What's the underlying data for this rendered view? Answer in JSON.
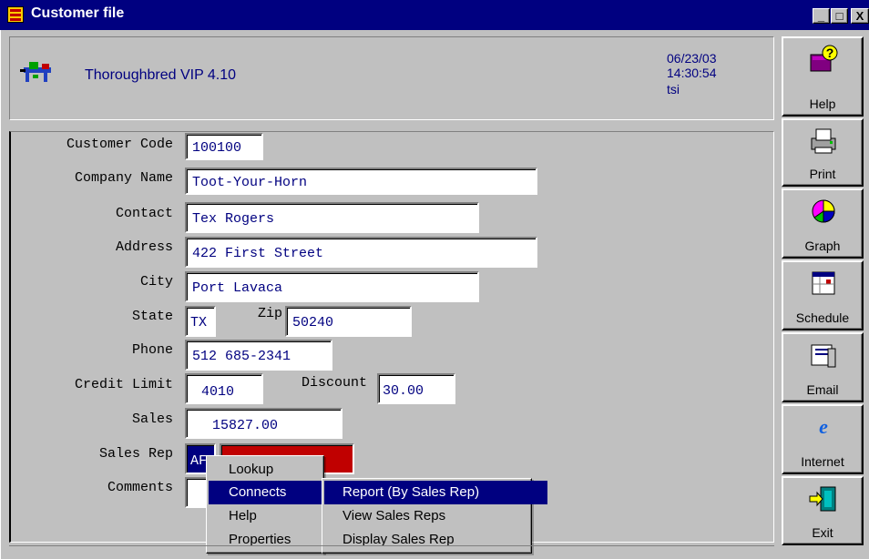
{
  "window": {
    "title": "Customer file",
    "buttons": [
      "_",
      "□",
      "X"
    ]
  },
  "header": {
    "app_name": "Thoroughbred VIP 4.10",
    "date": "06/23/03",
    "time": "14:30:54",
    "user": "tsi",
    "logo_icon": "running-horse-icon"
  },
  "form": {
    "customer_code": {
      "label": "Customer Code",
      "value": "100100"
    },
    "company_name": {
      "label": "Company Name",
      "value": "Toot-Your-Horn"
    },
    "contact": {
      "label": "Contact",
      "value": "Tex Rogers"
    },
    "address": {
      "label": "Address",
      "value": "422 First Street"
    },
    "city": {
      "label": "City",
      "value": "Port Lavaca"
    },
    "state": {
      "label": "State",
      "value": "TX"
    },
    "zip": {
      "label": "Zip",
      "value": "50240"
    },
    "phone": {
      "label": "Phone",
      "value": "512 685-2341"
    },
    "credit_limit": {
      "label": "Credit Limit",
      "value": "4010"
    },
    "discount": {
      "label": "Discount",
      "value": "30.00"
    },
    "sales": {
      "label": "Sales",
      "value": "15827.00"
    },
    "sales_rep": {
      "label": "Sales Rep",
      "code": "AF",
      "name_field_color": "#c00000"
    },
    "comments": {
      "label": "Comments",
      "value": ""
    }
  },
  "toolbar": [
    {
      "label": "Help",
      "icon": "help-book-question-icon"
    },
    {
      "label": "Print",
      "icon": "printer-icon"
    },
    {
      "label": "Graph",
      "icon": "pie-chart-icon"
    },
    {
      "label": "Schedule",
      "icon": "calendar-icon"
    },
    {
      "label": "Email",
      "icon": "mail-icon"
    },
    {
      "label": "Internet",
      "icon": "internet-explorer-icon"
    },
    {
      "label": "Exit",
      "icon": "exit-door-icon"
    }
  ],
  "context_menu": {
    "items": [
      "Lookup",
      "Connects",
      "Help",
      "Properties"
    ],
    "highlighted": "Connects",
    "submenu_arrow_icon": "chevron-right-icon",
    "submenu": {
      "items": [
        "Report (By Sales Rep)",
        "View Sales Reps",
        "Display Sales Rep"
      ],
      "highlighted": "Report (By Sales Rep)"
    }
  },
  "colors": {
    "title_bar": "#000080",
    "face": "#c0c0c0",
    "field_text": "#000080",
    "highlight": "#000080"
  }
}
